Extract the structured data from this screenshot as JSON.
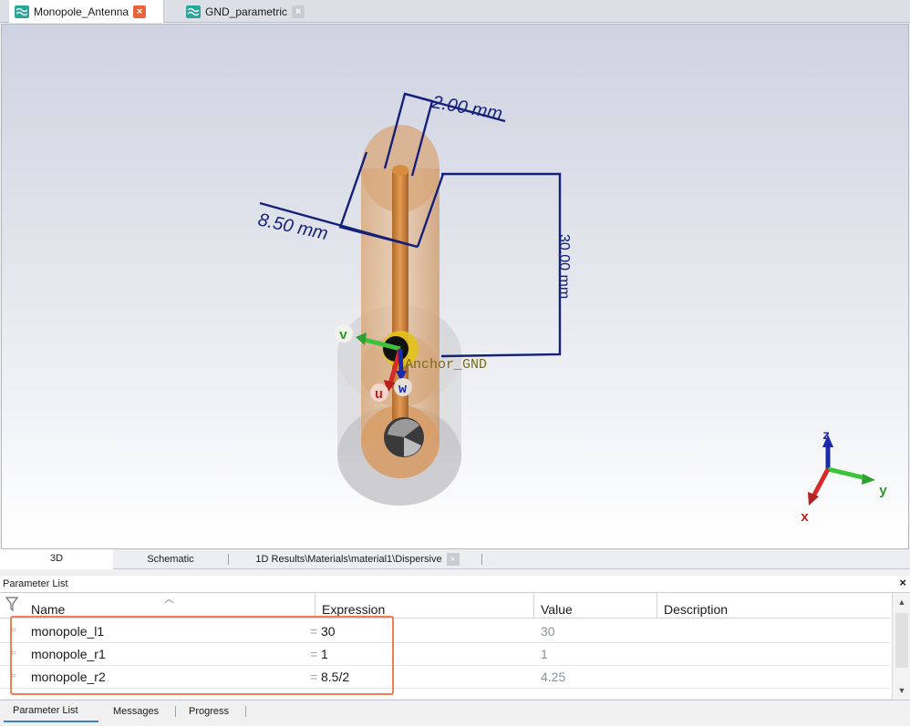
{
  "doc_tabs": [
    {
      "label": "Monopole_Antenna",
      "icon": "antenna-icon",
      "active": true
    },
    {
      "label": "GND_parametric",
      "icon": "antenna-icon",
      "active": false
    }
  ],
  "viewport": {
    "dim_top": "2.00 mm",
    "dim_left": "8.50 mm",
    "dim_right": "30.00 mm",
    "anchor_label": "Anchor_GND",
    "local_axes": {
      "u": "u",
      "v": "v",
      "w": "w"
    },
    "global_axes": {
      "x": "x",
      "y": "y",
      "z": "z"
    },
    "colors": {
      "dimension": "#14207a",
      "copper": "#c8864f",
      "u_axis": "#d62a2a",
      "v_axis": "#3bc43b",
      "w_axis": "#1a2aa8"
    }
  },
  "view_tabs": [
    {
      "label": "3D",
      "active": true
    },
    {
      "label": "Schematic",
      "active": false
    },
    {
      "label": "1D Results\\Materials\\material1\\Dispersive",
      "active": false
    }
  ],
  "panel": {
    "title": "Parameter List",
    "close": "×",
    "columns": {
      "name": "Name",
      "expression": "Expression",
      "value": "Value",
      "description": "Description"
    },
    "rows": [
      {
        "name": "monopole_l1",
        "expression": "30",
        "value": "30"
      },
      {
        "name": "monopole_r1",
        "expression": "1",
        "value": "1"
      },
      {
        "name": "monopole_r2",
        "expression": "8.5/2",
        "value": "4.25"
      }
    ],
    "eq_sign": "="
  },
  "bottom_tabs": [
    {
      "label": "Parameter List",
      "active": true
    },
    {
      "label": "Messages",
      "active": false
    },
    {
      "label": "Progress",
      "active": false
    }
  ]
}
